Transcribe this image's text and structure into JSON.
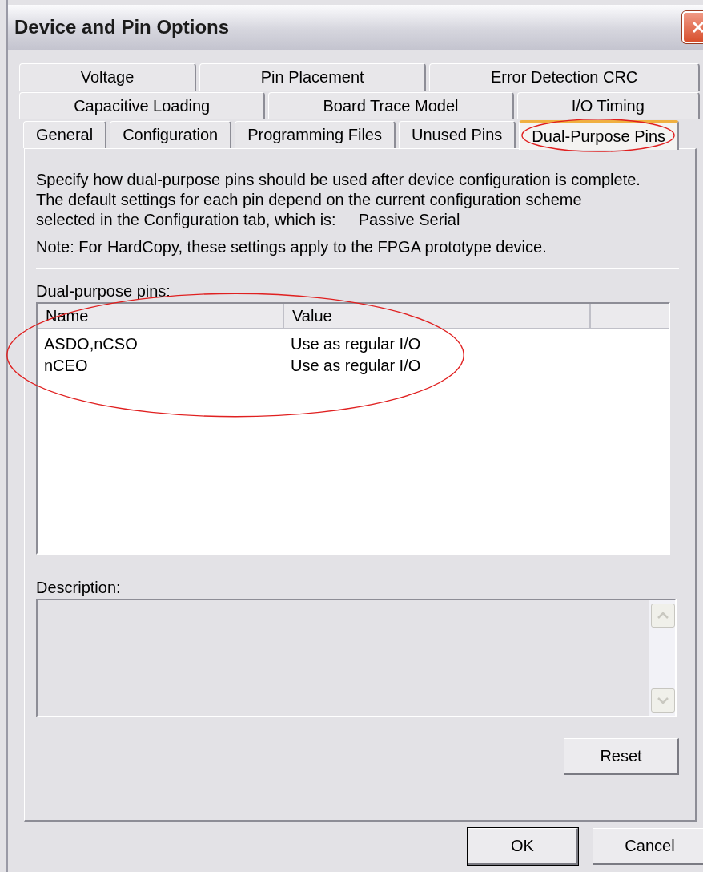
{
  "window": {
    "title": "Device and Pin Options"
  },
  "tab_rows": [
    [
      {
        "label": "Voltage",
        "selected": false,
        "circled": false
      },
      {
        "label": "Pin Placement",
        "selected": false,
        "circled": false
      },
      {
        "label": "Error Detection CRC",
        "selected": false,
        "circled": false
      }
    ],
    [
      {
        "label": "Capacitive Loading",
        "selected": false,
        "circled": false
      },
      {
        "label": "Board Trace Model",
        "selected": false,
        "circled": false
      },
      {
        "label": "I/O Timing",
        "selected": false,
        "circled": false
      }
    ],
    [
      {
        "label": "General",
        "selected": false,
        "circled": false
      },
      {
        "label": "Configuration",
        "selected": false,
        "circled": false
      },
      {
        "label": "Programming Files",
        "selected": false,
        "circled": false
      },
      {
        "label": "Unused Pins",
        "selected": false,
        "circled": false
      },
      {
        "label": "Dual-Purpose Pins",
        "selected": true,
        "circled": true
      }
    ]
  ],
  "intro": "Specify how dual-purpose pins should be used after device configuration is complete.\nThe default settings for each pin depend on the current configuration scheme\nselected in the Configuration tab, which is:",
  "scheme": "Passive Serial",
  "note": "Note: For HardCopy, these settings apply to the FPGA prototype device.",
  "pins": {
    "label": "Dual-purpose pins:",
    "circled": true,
    "columns": [
      "Name",
      "Value"
    ],
    "rows": [
      {
        "name": "ASDO,nCSO",
        "value": "Use as regular I/O"
      },
      {
        "name": "nCEO",
        "value": "Use as regular I/O"
      }
    ]
  },
  "description": {
    "label": "Description:"
  },
  "reset": "Reset",
  "buttons": [
    "OK",
    "Cancel"
  ]
}
